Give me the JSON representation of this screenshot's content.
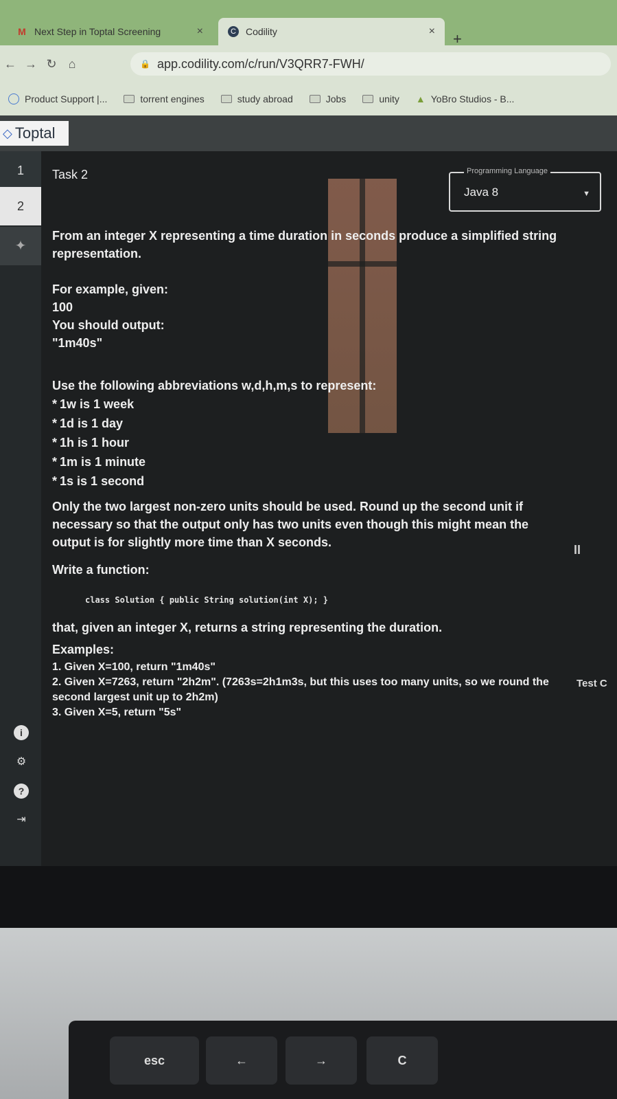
{
  "browser": {
    "tabs": [
      {
        "title": "Next Step in Toptal Screening",
        "icon": "gmail-icon",
        "close": "×"
      },
      {
        "title": "Codility",
        "icon": "codility-icon",
        "close": "×"
      }
    ],
    "new_tab": "+",
    "url": "app.codility.com/c/run/V3QRR7-FWH/",
    "bookmarks": [
      {
        "label": "Product Support |...",
        "icon": "globe-icon"
      },
      {
        "label": "torrent engines",
        "icon": "folder-icon"
      },
      {
        "label": "study abroad",
        "icon": "folder-icon"
      },
      {
        "label": "Jobs",
        "icon": "folder-icon"
      },
      {
        "label": "unity",
        "icon": "folder-icon"
      },
      {
        "label": "YoBro Studios - B...",
        "icon": "yobro-icon"
      }
    ]
  },
  "header": {
    "logo": "Toptal"
  },
  "rail": {
    "task1": "1",
    "task2": "2"
  },
  "task": {
    "title": "Task 2",
    "language_label": "Programming Language",
    "language_value": "Java 8",
    "intro": "From an integer X representing a time duration in seconds produce a simplified string representation.",
    "example_intro": "For example, given:",
    "example_input": "100",
    "example_output_label": "You should output:",
    "example_output": "\"1m40s\"",
    "abbr_intro": "Use the following abbreviations w,d,h,m,s to represent:",
    "abbreviations": [
      "1w is 1 week",
      "1d is 1 day",
      "1h is 1 hour",
      "1m is 1 minute",
      "1s is 1 second"
    ],
    "rule": "Only the two largest non-zero units should be used. Round up the second unit if necessary so that the output only has two units even though this might mean the output is for slightly more time than X seconds.",
    "write": "Write a function:",
    "signature": "class Solution { public String solution(int X); }",
    "returns": "that, given an integer X, returns a string representing the duration.",
    "examples_heading": "Examples:",
    "examples": [
      "1. Given X=100, return \"1m40s\"",
      "2. Given X=7263, return \"2h2m\". (7263s=2h1m3s, but this uses too many units, so we round the second largest unit up to 2h2m)",
      "3. Given X=5, return \"5s\""
    ]
  },
  "side": {
    "pause": "II",
    "test_cases": "Test C"
  },
  "bezel": {
    "letter": "M"
  },
  "keyboard": {
    "esc": "esc",
    "back": "←",
    "forward": "→",
    "refresh": "C"
  }
}
